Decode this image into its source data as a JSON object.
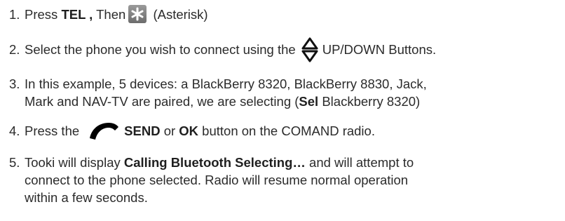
{
  "steps": [
    {
      "num": "1.",
      "a": "Press ",
      "b1": "TEL ,",
      "c": " Then",
      "d": " (Asterisk)",
      "icon": "asterisk-icon"
    },
    {
      "num": "2.",
      "a": "Select the phone you wish to connect using the",
      "b": "UP/DOWN Buttons.",
      "icon": "up-down-arrows-icon"
    },
    {
      "num": "3.",
      "line1": "In this example, 5 devices: a BlackBerry 8320, BlackBerry 8830, Jack,",
      "line2a": "Mark and NAV-TV are paired, we are selecting (",
      "line2b": "Sel",
      "line2c": " Blackberry 8320)"
    },
    {
      "num": "4.",
      "a": "Press the",
      "b1": "SEND",
      "c": " or ",
      "b2": "OK",
      "d": " button on the COMAND radio.",
      "icon": "phone-send-icon"
    },
    {
      "num": "5.",
      "a": "Tooki will display ",
      "b1": "Calling Bluetooth Selecting…",
      "c": " and will attempt to",
      "line2": "connect to the phone selected. Radio will resume normal operation",
      "line3": "within a few seconds."
    }
  ]
}
